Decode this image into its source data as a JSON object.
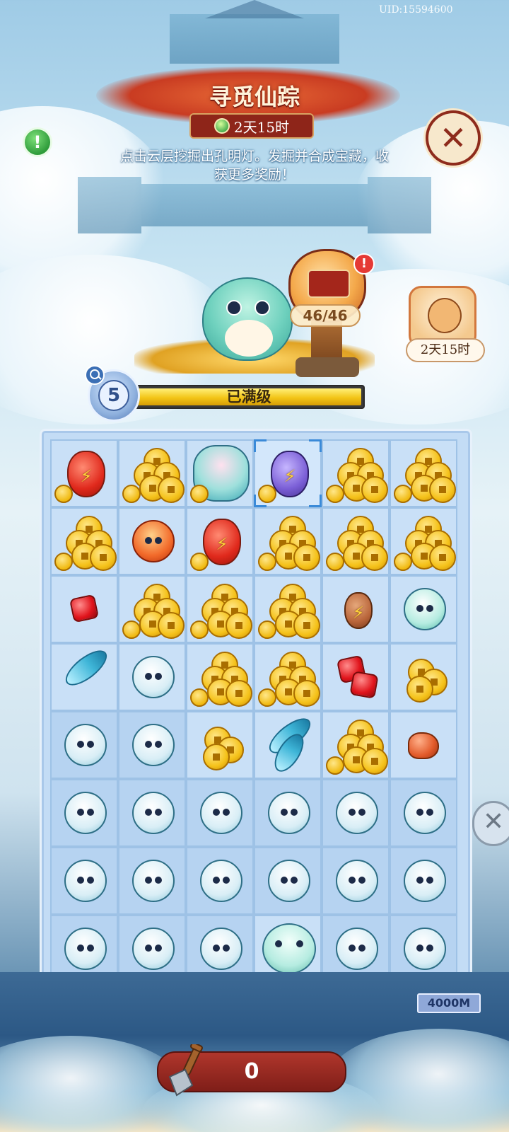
{
  "header": {
    "uid": "UID:15594600",
    "title": "寻觅仙踪",
    "timer": "2天15时",
    "description": "点击云层挖掘出孔明灯。发掘并合成宝藏，收获更多奖励！",
    "info_icon": "info-exclamation-icon",
    "close_icon": "close-icon"
  },
  "lantern": {
    "count": "46/46",
    "badge": "!",
    "icon": "lantern-icon"
  },
  "event": {
    "timer": "2天15时",
    "icon": "lucky-cat-icon"
  },
  "level": {
    "value": "5",
    "status": "已满级",
    "progress": 1.0
  },
  "board": {
    "rows": 8,
    "cols": 6,
    "cells": [
      [
        "red-gourd",
        "coins",
        "phoenix",
        "purple-gourd",
        "coins",
        "coins"
      ],
      [
        "coins",
        "fire-sprite",
        "red-gourd",
        "coins",
        "coins",
        "coins"
      ],
      [
        "red-gem",
        "coins",
        "coins",
        "coins",
        "brown-gourd",
        "teal-bird"
      ],
      [
        "feather",
        "white-owl",
        "coins",
        "coins",
        "red-gems",
        "coin-stack"
      ],
      [
        "",
        "",
        "coin-stack",
        "feather-bundle",
        "coins",
        "orange-ore"
      ],
      [
        "",
        "",
        "",
        "",
        "",
        ""
      ],
      [
        "",
        "",
        "",
        "",
        "",
        ""
      ],
      [
        "",
        "",
        "",
        "cloud-cat",
        "",
        ""
      ]
    ],
    "selected": [
      0,
      3
    ]
  },
  "footer": {
    "depth": "4000M",
    "shovels": "0",
    "shovel_icon": "shovel-icon"
  },
  "colors": {
    "accent_red": "#8e2519",
    "gold": "#f3c517",
    "board_bg": "#c3dcf5"
  }
}
